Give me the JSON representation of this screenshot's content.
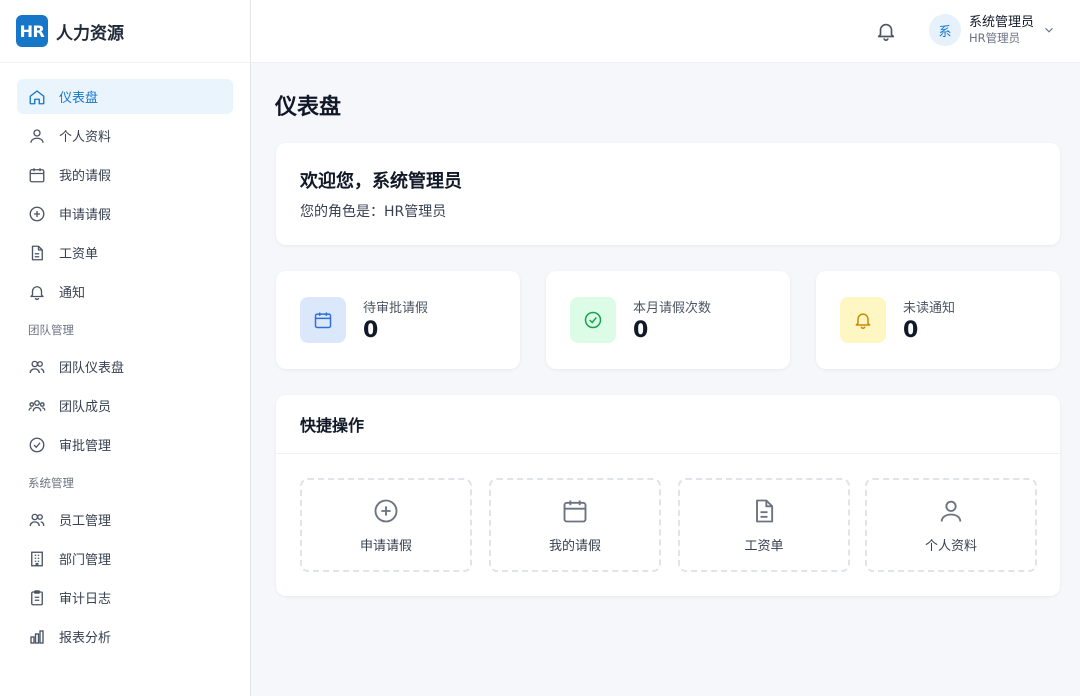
{
  "brand": {
    "logo": "HR",
    "name": "人力资源"
  },
  "sidebar": {
    "main_items": [
      {
        "label": "仪表盘",
        "icon": "home-icon",
        "active": true
      },
      {
        "label": "个人资料",
        "icon": "user-icon"
      },
      {
        "label": "我的请假",
        "icon": "calendar-icon"
      },
      {
        "label": "申请请假",
        "icon": "plus-circle-icon"
      },
      {
        "label": "工资单",
        "icon": "document-icon"
      },
      {
        "label": "通知",
        "icon": "bell-icon"
      }
    ],
    "team_section": "团队管理",
    "team_items": [
      {
        "label": "团队仪表盘",
        "icon": "users-icon"
      },
      {
        "label": "团队成员",
        "icon": "group-icon"
      },
      {
        "label": "审批管理",
        "icon": "check-circle-icon"
      }
    ],
    "system_section": "系统管理",
    "system_items": [
      {
        "label": "员工管理",
        "icon": "users-icon"
      },
      {
        "label": "部门管理",
        "icon": "building-icon"
      },
      {
        "label": "审计日志",
        "icon": "clipboard-icon"
      },
      {
        "label": "报表分析",
        "icon": "bar-chart-icon"
      }
    ]
  },
  "header": {
    "avatar_text": "系",
    "user_name": "系统管理员",
    "user_role": "HR管理员"
  },
  "page": {
    "title": "仪表盘"
  },
  "welcome": {
    "title": "欢迎您，系统管理员",
    "subtitle": "您的角色是：HR管理员"
  },
  "stats": [
    {
      "label": "待审批请假",
      "value": "0",
      "icon": "calendar-icon",
      "color": "#2f6fd6",
      "bg": "#dbe8fb"
    },
    {
      "label": "本月请假次数",
      "value": "0",
      "icon": "check-circle-icon",
      "color": "#16a34a",
      "bg": "#dcfce7"
    },
    {
      "label": "未读通知",
      "value": "0",
      "icon": "bell-icon",
      "color": "#ca8a04",
      "bg": "#fef6c3"
    }
  ],
  "quick": {
    "title": "快捷操作",
    "items": [
      {
        "label": "申请请假",
        "icon": "plus-circle-icon"
      },
      {
        "label": "我的请假",
        "icon": "calendar-icon"
      },
      {
        "label": "工资单",
        "icon": "document-icon"
      },
      {
        "label": "个人资料",
        "icon": "user-icon"
      }
    ]
  },
  "colors": {
    "accent": "#1677c8",
    "active_bg": "#eaf4fd"
  }
}
